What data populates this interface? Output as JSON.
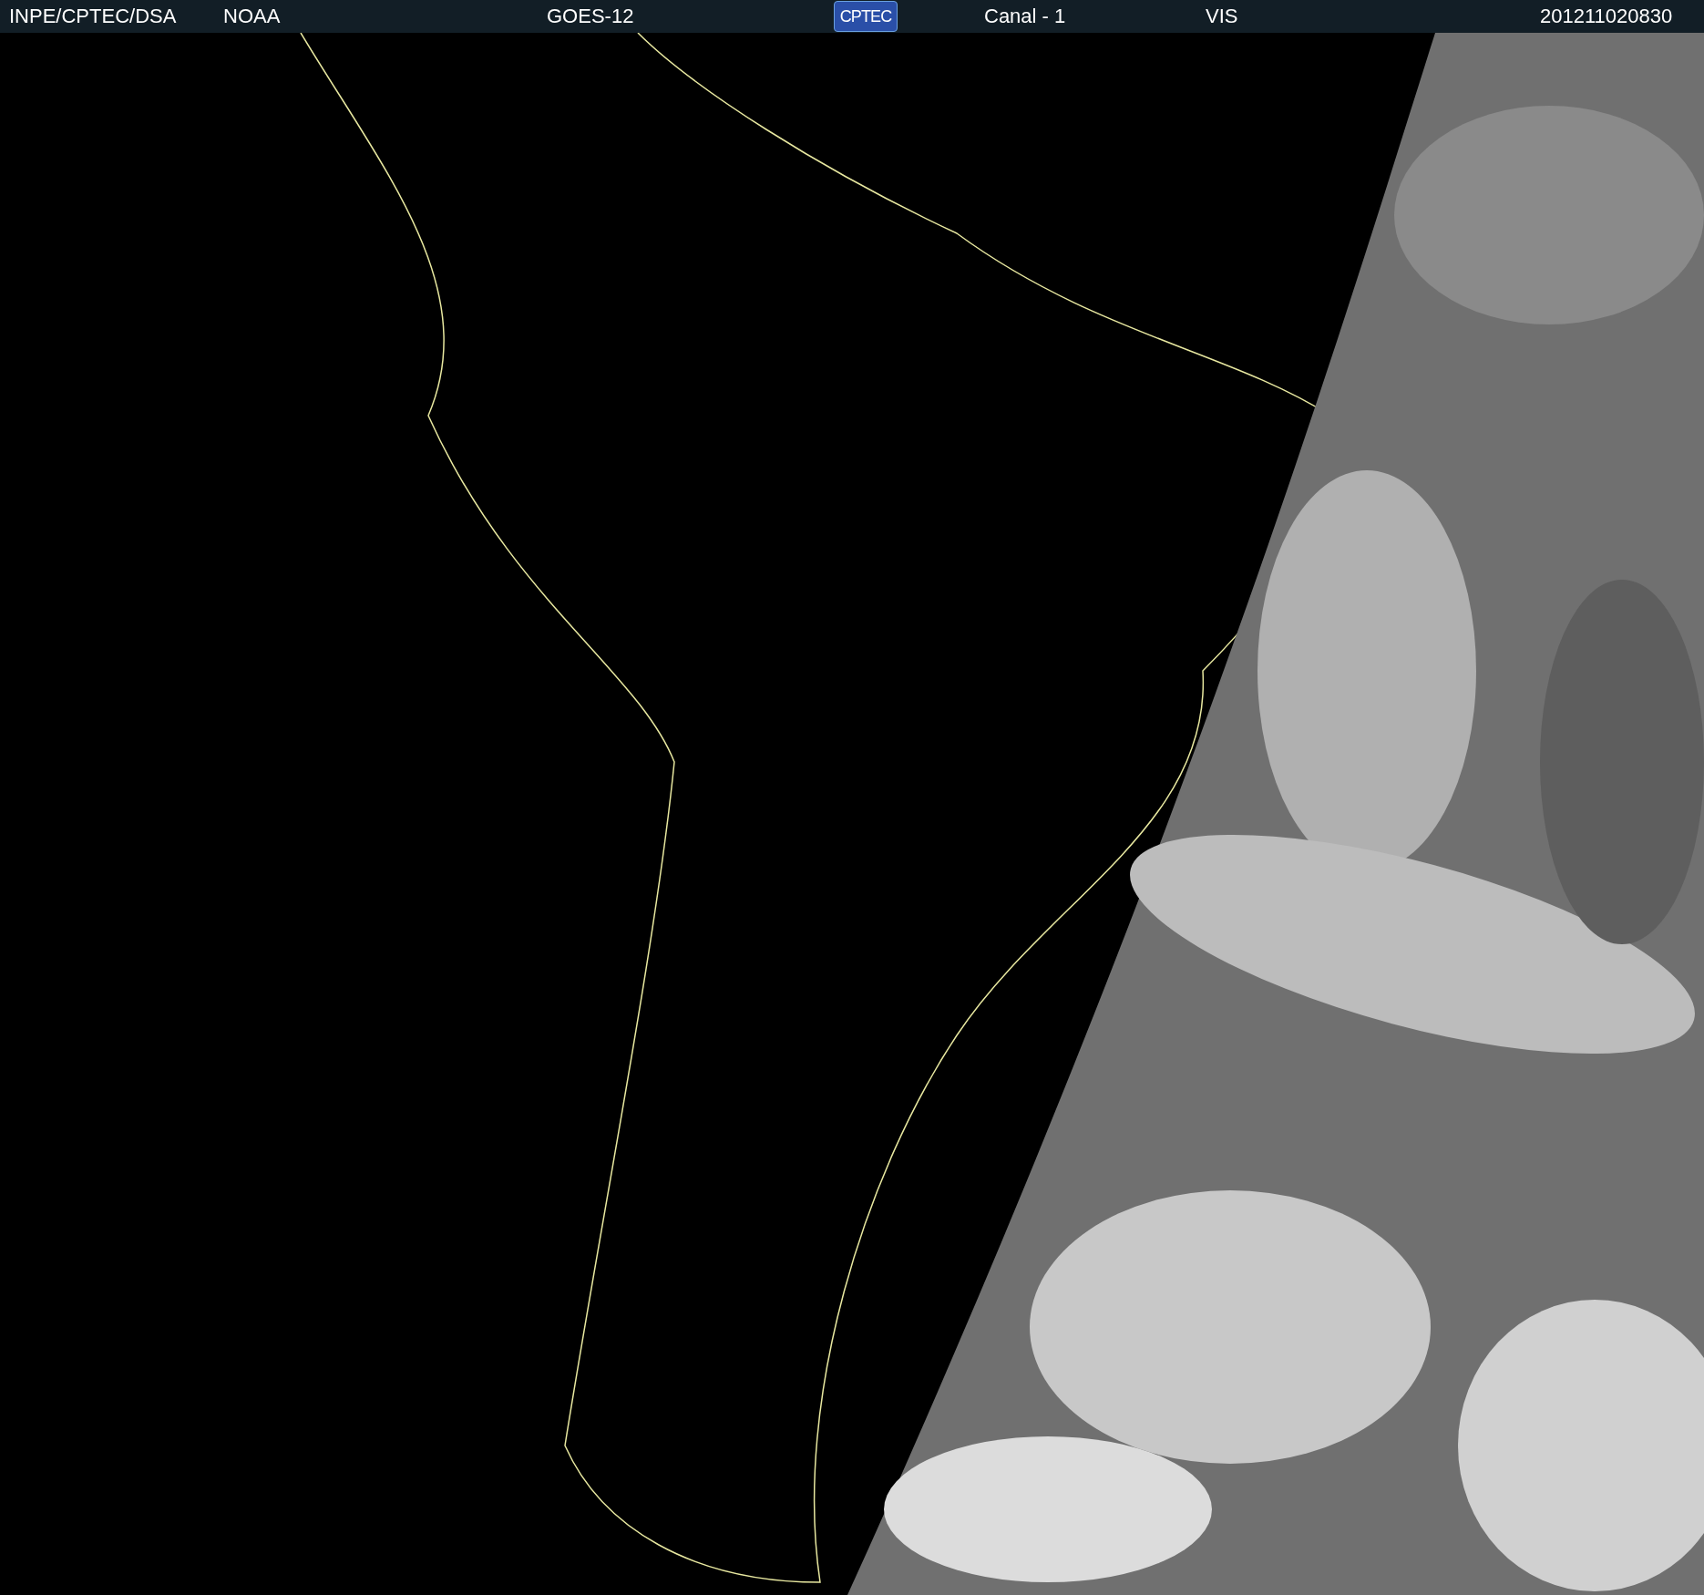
{
  "header": {
    "source": "INPE/CPTEC/DSA",
    "agency": "NOAA",
    "satellite": "GOES-12",
    "logo": "CPTEC",
    "channel": "Canal - 1",
    "band": "VIS",
    "timestamp": "201211020830"
  }
}
